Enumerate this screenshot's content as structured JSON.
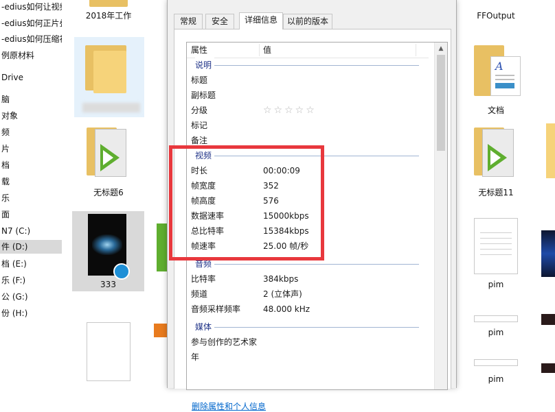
{
  "nav": {
    "items": [
      {
        "label": "-edius如何让视频",
        "selected": false
      },
      {
        "label": "-edius如何正片叠",
        "selected": false
      },
      {
        "label": "-edius如何压缩视",
        "selected": false
      },
      {
        "label": "例原材料",
        "selected": false
      },
      {
        "label": "Drive",
        "selected": false
      },
      {
        "label": "脑",
        "selected": false
      },
      {
        "label": "对象",
        "selected": false
      },
      {
        "label": "频",
        "selected": false
      },
      {
        "label": "片",
        "selected": false
      },
      {
        "label": "档",
        "selected": false
      },
      {
        "label": "载",
        "selected": false
      },
      {
        "label": "乐",
        "selected": false
      },
      {
        "label": "面",
        "selected": false
      },
      {
        "label": "N7 (C:)",
        "selected": false
      },
      {
        "label": "件 (D:)",
        "selected": true
      },
      {
        "label": "档 (E:)",
        "selected": false
      },
      {
        "label": "乐 (F:)",
        "selected": false
      },
      {
        "label": "公 (G:)",
        "selected": false
      },
      {
        "label": "份 (H:)",
        "selected": false
      }
    ]
  },
  "files": {
    "folder_2018": "2018年工作",
    "video_untitled6": "无标题6",
    "video_333": "333",
    "ffoutput": "FFOutput",
    "doc_wendang": "文档",
    "video_untitled11": "无标题11",
    "pim1": "pim",
    "pim2": "pim",
    "pim3": "pim"
  },
  "dialog": {
    "tabs": [
      {
        "label": "常规",
        "active": false
      },
      {
        "label": "安全",
        "active": false
      },
      {
        "label": "详细信息",
        "active": true
      },
      {
        "label": "以前的版本",
        "active": false
      }
    ],
    "header": {
      "property": "属性",
      "value": "值"
    },
    "groups": {
      "description": "说明",
      "video": "视频",
      "audio": "音频",
      "media": "媒体"
    },
    "rows": {
      "title": {
        "k": "标题",
        "v": ""
      },
      "subtitle": {
        "k": "副标题",
        "v": ""
      },
      "rating": {
        "k": "分级",
        "v": "☆☆☆☆☆"
      },
      "tags": {
        "k": "标记",
        "v": ""
      },
      "comments": {
        "k": "备注",
        "v": ""
      },
      "duration": {
        "k": "时长",
        "v": "00:00:09"
      },
      "frame_width": {
        "k": "帧宽度",
        "v": "352"
      },
      "frame_height": {
        "k": "帧高度",
        "v": "576"
      },
      "data_rate": {
        "k": "数据速率",
        "v": "15000kbps"
      },
      "total_bitrate": {
        "k": "总比特率",
        "v": "15384kbps"
      },
      "frame_rate": {
        "k": "帧速率",
        "v": "25.00 帧/秒"
      },
      "bitrate": {
        "k": "比特率",
        "v": "384kbps"
      },
      "channels": {
        "k": "频道",
        "v": "2 (立体声)"
      },
      "sample_rate": {
        "k": "音频采样频率",
        "v": "48.000 kHz"
      },
      "contributing_artists": {
        "k": "参与创作的艺术家",
        "v": ""
      },
      "year": {
        "k": "年",
        "v": ""
      }
    },
    "remove_link": "删除属性和个人信息"
  },
  "colors": {
    "highlight": "#e8383d",
    "group_text": "#1e3287",
    "link": "#0066cc"
  }
}
